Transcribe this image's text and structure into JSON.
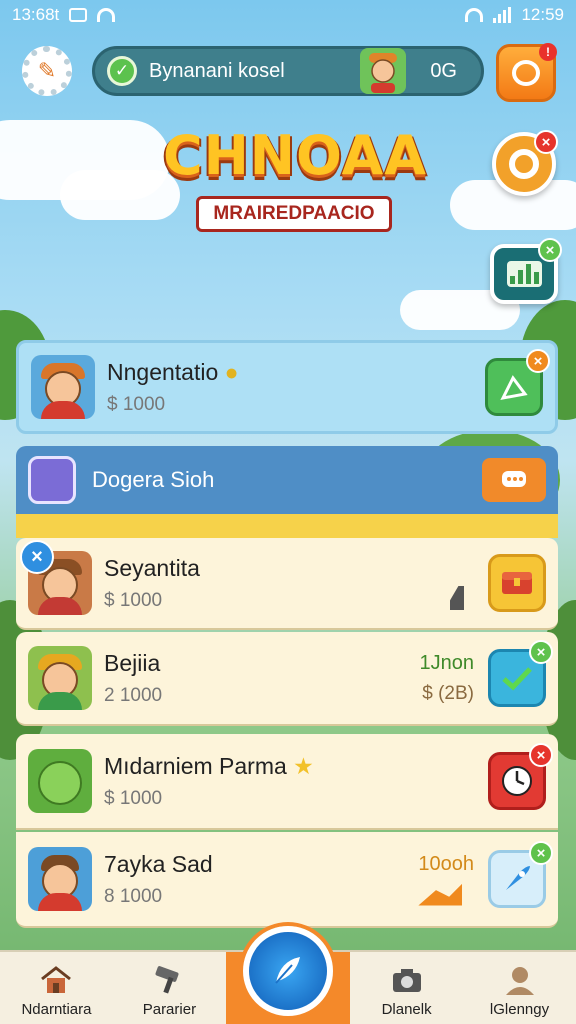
{
  "status_bar": {
    "time": "13:68t",
    "right_time": "12:59"
  },
  "header": {
    "player_name": "Bynanani kosel",
    "score": "0G"
  },
  "logo": {
    "title": "CHNOAA",
    "subtitle": "MRAIREDPAACIO"
  },
  "featured_card": {
    "name": "Nngentatio",
    "amount": "$ 1000"
  },
  "clan": {
    "label": "Dogera Sioh"
  },
  "list": [
    {
      "name": "Seyantita",
      "amount": "$ 1000",
      "meta_top": "",
      "meta_bot": ""
    },
    {
      "name": "Bejiia",
      "amount": "2 1000",
      "meta_top": "1Jnon",
      "meta_bot": "$ (2B)"
    },
    {
      "name": "Mıdarniem Parma",
      "amount": "$ 1000",
      "meta_top": "",
      "meta_bot": ""
    },
    {
      "name": "7ayka Sad",
      "amount": "8 1000",
      "meta_top": "10ooh",
      "meta_bot": ""
    }
  ],
  "nav": {
    "items": [
      {
        "label": "Ndarntiara",
        "icon": "home-icon"
      },
      {
        "label": "Pararier",
        "icon": "hammer-icon"
      },
      {
        "label": "",
        "icon": "feather-icon"
      },
      {
        "label": "Dlanelk",
        "icon": "camera-icon"
      },
      {
        "label": "lGlenngy",
        "icon": "profile-icon"
      }
    ]
  },
  "colors": {
    "accent": "#f4892a",
    "primary": "#1c72c8",
    "card": "#fdf4da"
  }
}
